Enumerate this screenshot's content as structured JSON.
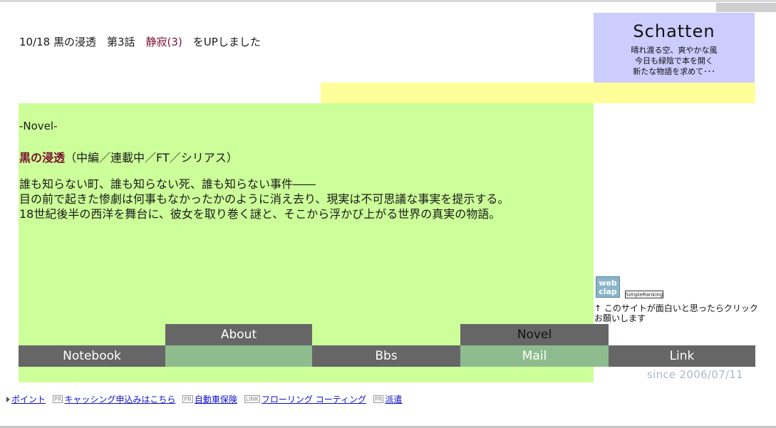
{
  "update": {
    "prefix": "10/18 黒の浸透　第3話　",
    "link": "静寂(3)",
    "suffix": "　をUPしました"
  },
  "logo": {
    "title": "Schatten",
    "lines": [
      "晴れ渡る空、爽やかな風",
      "今日も緑陰で本を開く",
      "新たな物語を求めて･･･"
    ]
  },
  "main": {
    "section_title": "-Novel-",
    "novel_title": "黒の浸透",
    "novel_meta": "（中編／連載中／FT／シリアス）",
    "description": [
      "誰も知らない町、誰も知らない死、誰も知らない事件――",
      "目の前で起きた惨劇は何事もなかったかのように消え去り、現実は不可思議な事実を提示する。",
      "18世紀後半の西洋を舞台に、彼女を取り巻く謎と、そこから浮かび上がる世界の真実の物語。"
    ]
  },
  "clap": {
    "button_text": "web clap",
    "ranking_label": "SimpleRanking",
    "note": "↑ このサイトが面白いと思ったらクリックお願いします"
  },
  "nav": {
    "about": "About",
    "novel": "Novel",
    "notebook": "Notebook",
    "bbs": "Bbs",
    "mail": "Mail",
    "link": "Link"
  },
  "since": "since 2006/07/11",
  "footer": {
    "pr_icon": "PR",
    "link_icon": "LINK",
    "links": [
      "ポイント",
      "キャッシング申込みはこちら",
      "自動車保険",
      "フローリング コーティング",
      "派遣"
    ]
  },
  "colors": {
    "main_bg": "#ccff99",
    "logo_bg": "#ccccff",
    "band": "#ffff99",
    "nav_dark": "#666666",
    "nav_green": "#8fbc8f",
    "accent_link": "#7a1030"
  }
}
